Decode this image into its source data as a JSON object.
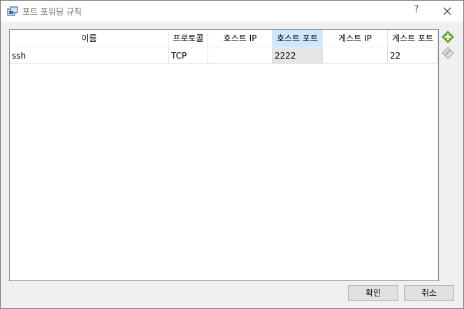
{
  "window": {
    "title": "포트 포워딩 규칙",
    "help": "?"
  },
  "table": {
    "columns": [
      "이름",
      "프로토콜",
      "호스트 IP",
      "호스트 포트",
      "게스트 IP",
      "게스트 포트"
    ],
    "rows": [
      {
        "name": "ssh",
        "protocol": "TCP",
        "host_ip": "",
        "host_port": "2222",
        "guest_ip": "",
        "guest_port": "22"
      }
    ]
  },
  "buttons": {
    "ok": "확인",
    "cancel": "취소"
  },
  "icons": {
    "add": "add-rule-icon",
    "remove": "remove-rule-icon"
  }
}
